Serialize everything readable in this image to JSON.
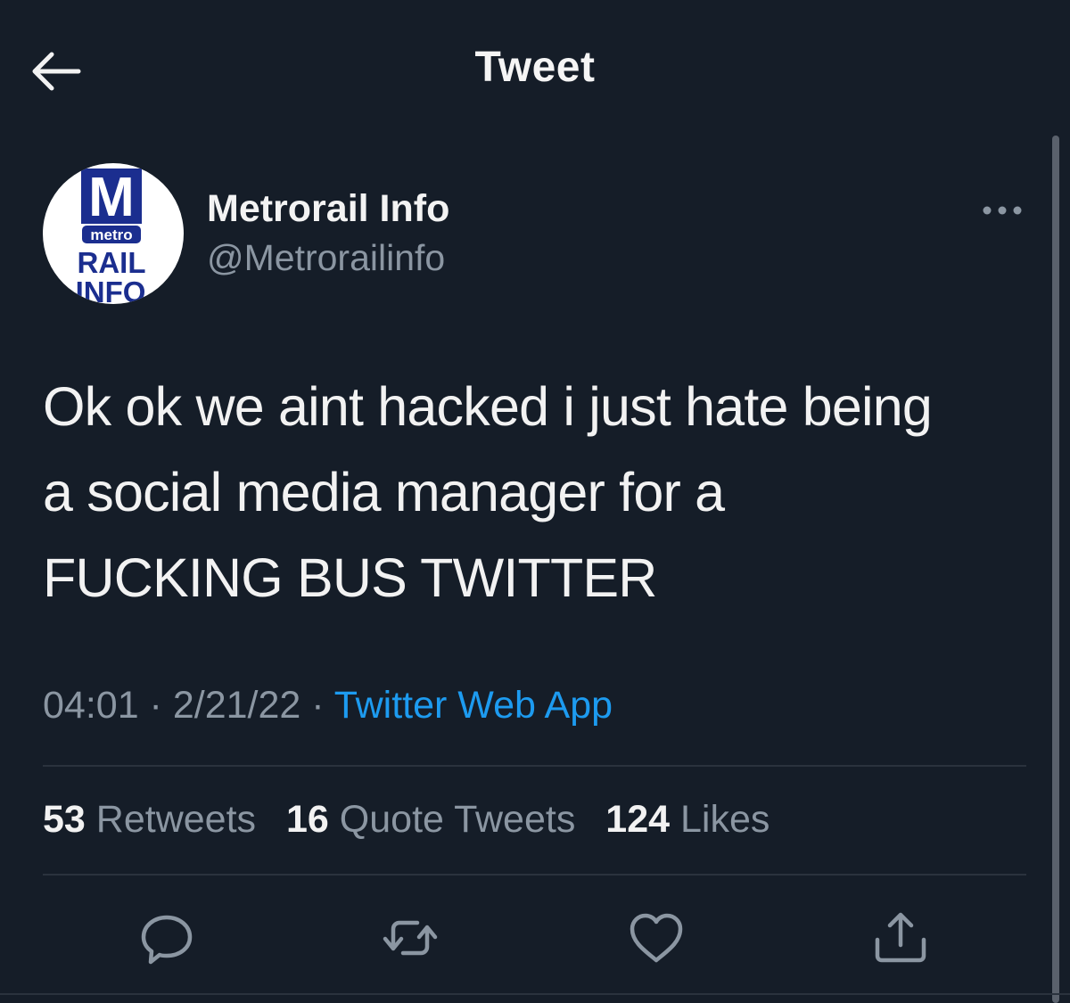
{
  "header": {
    "title": "Tweet",
    "back_icon": "arrow-left-icon"
  },
  "avatar": {
    "logo_text_m": "M",
    "logo_text_metro": "metro",
    "logo_text_rail": "RAIL",
    "logo_text_info": "INFO"
  },
  "author": {
    "display_name": "Metrorail Info",
    "handle": "@Metrorailinfo"
  },
  "tweet": {
    "lines": [
      "Ok ok we aint hacked i just hate being",
      "a social media manager for a",
      "FUCKING BUS TWITTER"
    ],
    "time": "04:01",
    "separator": " · ",
    "date": "2/21/22",
    "source": "Twitter Web App"
  },
  "stats": {
    "retweets_count": "53",
    "retweets_label": "Retweets",
    "quotes_count": "16",
    "quotes_label": "Quote Tweets",
    "likes_count": "124",
    "likes_label": "Likes"
  },
  "actions": [
    "reply-icon",
    "retweet-icon",
    "like-icon",
    "share-icon"
  ],
  "colors": {
    "background": "#151d28",
    "text": "#f2f2f2",
    "muted": "#8b96a2",
    "link": "#1d9bf0",
    "logo_blue": "#1b2e8f"
  }
}
